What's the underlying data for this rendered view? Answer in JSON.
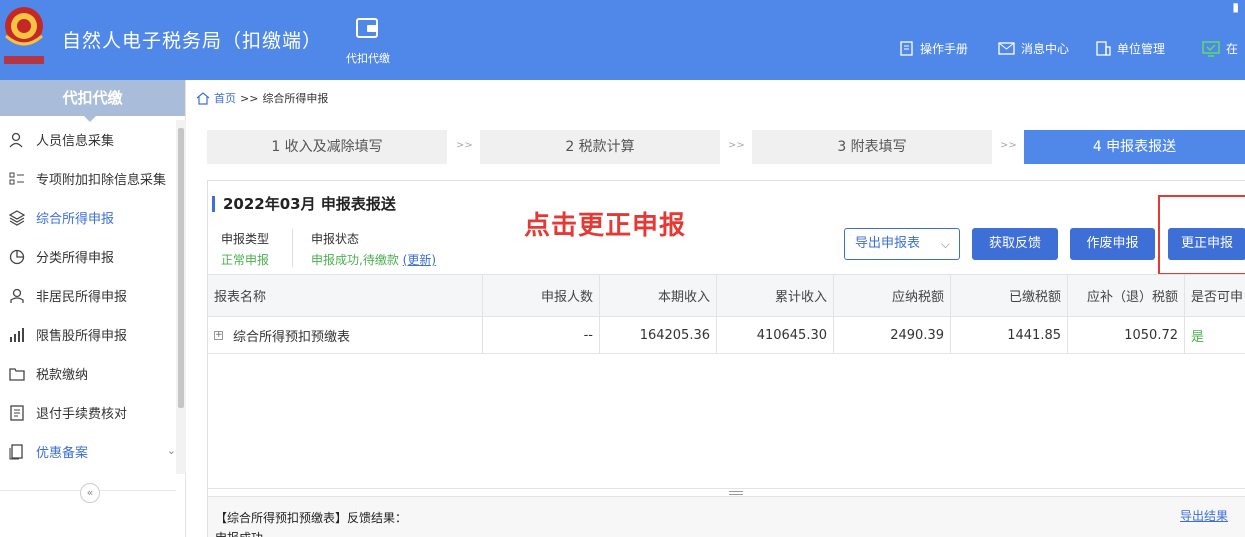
{
  "header": {
    "app_title": "自然人电子税务局（扣缴端）",
    "main_nav_label": "代扣代缴",
    "nav": [
      {
        "label": "操作手册",
        "icon": "manual-icon"
      },
      {
        "label": "消息中心",
        "icon": "message-icon"
      },
      {
        "label": "单位管理",
        "icon": "building-icon"
      },
      {
        "label": "在",
        "icon": "online-icon"
      }
    ],
    "logo_alt": "中国税务",
    "brand_color": "#4f88e8"
  },
  "sidebar": {
    "title": "代扣代缴",
    "items": [
      {
        "label": "人员信息采集",
        "icon": "person-icon"
      },
      {
        "label": "专项附加扣除信息采集",
        "icon": "list-icon"
      },
      {
        "label": "综合所得申报",
        "icon": "layers-icon",
        "active": true
      },
      {
        "label": "分类所得申报",
        "icon": "pie-icon"
      },
      {
        "label": "非居民所得申报",
        "icon": "user-outline-icon"
      },
      {
        "label": "限售股所得申报",
        "icon": "bar-chart-icon"
      },
      {
        "label": "税款缴纳",
        "icon": "folder-icon"
      },
      {
        "label": "退付手续费核对",
        "icon": "checklist-icon"
      },
      {
        "label": "优惠备案",
        "icon": "copy-icon"
      }
    ],
    "collapse_glyph": "«"
  },
  "breadcrumb": {
    "home": "首页",
    "sep": ">>",
    "current": "综合所得申报"
  },
  "steps": [
    {
      "label": "1 收入及减除填写"
    },
    {
      "label": "2 税款计算"
    },
    {
      "label": "3 附表填写"
    },
    {
      "label": "4 申报表报送",
      "active": true
    }
  ],
  "step_sep": ">>",
  "panel": {
    "title": "2022年03月  申报表报送",
    "report_type_label": "申报类型",
    "report_type_value": "正常申报",
    "report_status_label": "申报状态",
    "report_status_value": "申报成功,待缴款",
    "refresh_link": "(更新)",
    "annotation": "点击更正申报",
    "buttons": {
      "export": "导出申报表",
      "feedback": "获取反馈",
      "void": "作废申报",
      "correct": "更正申报"
    }
  },
  "table": {
    "headers": [
      "报表名称",
      "申报人数",
      "本期收入",
      "累计收入",
      "应纳税额",
      "已缴税额",
      "应补（退）税额",
      "是否可申"
    ],
    "rows": [
      {
        "name": "综合所得预扣预缴表",
        "count": "--",
        "current_income": "164205.36",
        "cumulative_income": "410645.30",
        "tax_payable": "2490.39",
        "tax_paid": "1441.85",
        "tax_due": "1050.72",
        "can_declare": "是"
      }
    ]
  },
  "result": {
    "text": "【综合所得预扣预缴表】反馈结果：",
    "text2": "申报成功",
    "export_link": "导出结果"
  }
}
